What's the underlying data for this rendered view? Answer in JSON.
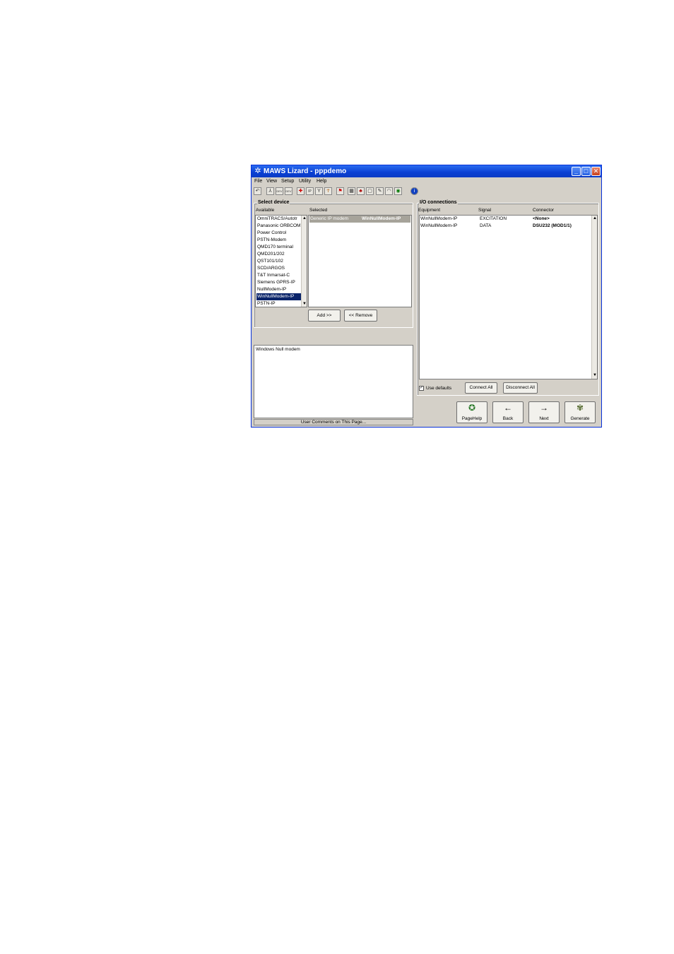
{
  "window": {
    "title": "MAWS Lizard - pppdemo",
    "icon": "lizard-icon"
  },
  "menu": [
    "File",
    "View",
    "Setup",
    "Utility",
    "Help"
  ],
  "toolbar": {
    "icons": [
      "undo-icon",
      "network-icon",
      "dev-icon",
      "dev-icon",
      "flag-cross-icon",
      "ip-icon",
      "antenna-icon",
      "runner-icon",
      "flag-icon",
      "table-icon",
      "group-icon",
      "page-icon",
      "pen-icon",
      "bell-icon",
      "globe-icon",
      "info-icon"
    ],
    "dev_label": "DEV",
    "ip_label": "IP"
  },
  "select_device": {
    "title": "Select device",
    "available_header": "Available",
    "selected_header": "Selected",
    "available": [
      "OmniTRACS/Autotr",
      "Panasonic ORBCOM",
      "Power Control",
      "PSTN-Modem",
      "QMD170 terminal",
      "QMD201/202",
      "QST101/102",
      "SCD/ARGOS",
      "T&T Inmarsat-C",
      "Siemens GPRS-IP",
      "NullModem-IP",
      "WinNullModem-IP",
      "PSTN-IP"
    ],
    "selected_available_index": 11,
    "selected": [
      {
        "type": "Generic IP modem",
        "name": "WinNullModem-IP"
      }
    ],
    "add_label": "Add >>",
    "remove_label": "<< Remove"
  },
  "comments": {
    "text": "Windows Null modem",
    "footer": "User Comments on This Page..."
  },
  "io": {
    "title": "I/O connections",
    "headers": [
      "Equipment",
      "Signal",
      "Connector"
    ],
    "rows": [
      {
        "equipment": "WinNullModem-IP",
        "signal": "EXCITATION",
        "connector": "<None>"
      },
      {
        "equipment": "WinNullModem-IP",
        "signal": "DATA",
        "connector": "DSU232 (MOD1/1)"
      }
    ],
    "use_defaults_label": "Use defaults",
    "use_defaults_checked": true,
    "check_mark": "✓",
    "connect_all_label": "Connect All",
    "disconnect_all_label": "Disconnect All"
  },
  "nav": {
    "pagehelp": "PageHelp",
    "back": "Back",
    "next": "Next",
    "generate": "Generate"
  }
}
